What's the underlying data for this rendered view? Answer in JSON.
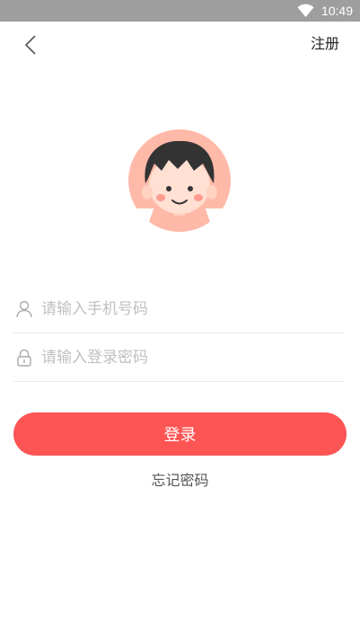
{
  "status_bar": {
    "time": "10:49",
    "icon": "wifi-icon"
  },
  "header": {
    "back_icon": "chevron-left-icon",
    "register_label": "注册"
  },
  "avatar": {
    "icon": "boy-avatar-icon"
  },
  "form": {
    "phone": {
      "icon": "user-icon",
      "placeholder": "请输入手机号码",
      "value": ""
    },
    "password": {
      "icon": "lock-icon",
      "placeholder": "请输入登录密码",
      "value": ""
    }
  },
  "actions": {
    "login_label": "登录",
    "forgot_label": "忘记密码"
  },
  "colors": {
    "accent": "#fd5454",
    "status_bar": "#9e9e9e",
    "avatar_bg": "#ffb9a8"
  }
}
